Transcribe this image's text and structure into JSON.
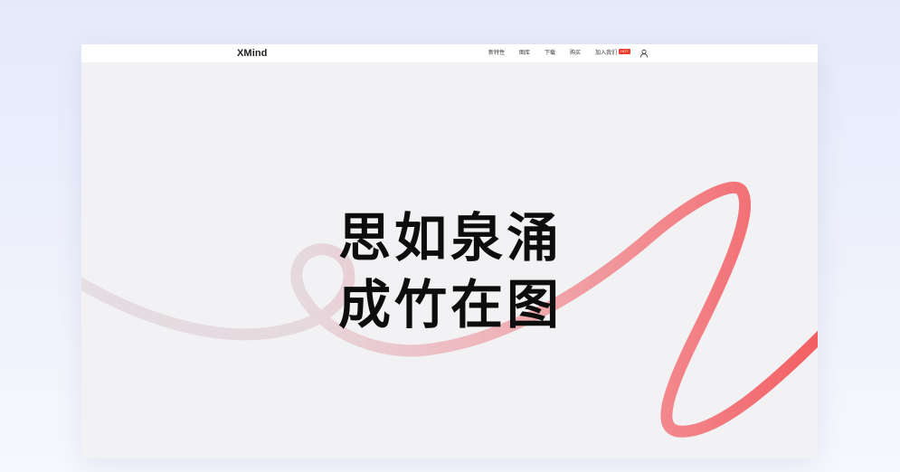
{
  "brand": {
    "name": "XMind"
  },
  "nav": {
    "items": [
      {
        "label": "新特性"
      },
      {
        "label": "图库"
      },
      {
        "label": "下载"
      },
      {
        "label": "购买"
      }
    ],
    "join": {
      "label": "加入我们",
      "badge": "HOT"
    }
  },
  "hero": {
    "line1": "思如泉涌",
    "line2": "成竹在图"
  },
  "colors": {
    "ribbon_start": "#e4dde2",
    "ribbon_end": "#f25f63",
    "background": "#f2f1f3"
  },
  "icons": {
    "user": "user-icon"
  }
}
